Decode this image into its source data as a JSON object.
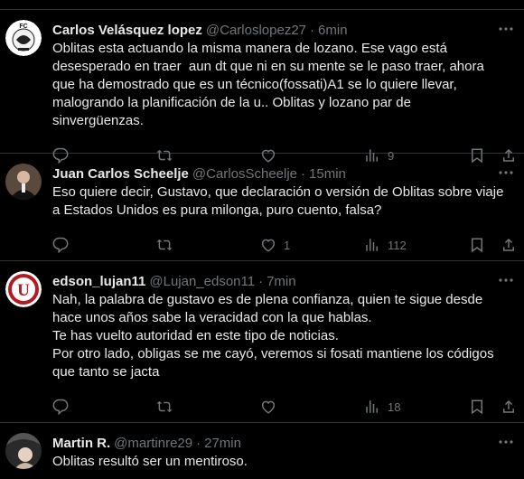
{
  "tweets": [
    {
      "display_name": "Carlos Velásquez lopez",
      "handle": "@Carloslopez27",
      "separator": "·",
      "time": "6min",
      "text": "Oblitas esta actuando la misma manera de lozano. Ese vago está desesperado en traer  aun dt que ni en su mente se le paso traer, ahora que ha demostrado que es un técnico(fossati)A1 se lo quiere llevar, malogrando la planificación de la u.. Oblitas y lozano par de sinvergüenzas.",
      "replies": "",
      "retweets": "",
      "likes": "",
      "views": "9",
      "avatar_label": "FC"
    },
    {
      "display_name": "Juan Carlos Scheelje",
      "handle": "@CarlosScheelje",
      "separator": "·",
      "time": "15min",
      "text": "Eso quiere decir, Gustavo, que declaración o versión de Oblitas sobre viaje a Estados Unidos es pura milonga, puro cuento, falsa?",
      "replies": "",
      "retweets": "",
      "likes": "1",
      "views": "112",
      "avatar_label": ""
    },
    {
      "display_name": "edson_lujan11",
      "handle": "@Lujan_edson11",
      "separator": "·",
      "time": "7min",
      "text": "Nah, la palabra de gustavo es de plena confianza, quien te sigue desde hace unos años sabe la veracidad con la que hablas.\nTe has vuelto autoridad en este tipo de noticias.\nPor otro lado, obligas se me cayó, veremos si fosati mantiene los códigos que tanto se jacta",
      "replies": "",
      "retweets": "",
      "likes": "",
      "views": "18",
      "avatar_label": "U"
    },
    {
      "display_name": "Martin R.",
      "handle": "@martinre29",
      "separator": "·",
      "time": "27min",
      "text": "Oblitas resultó ser un mentiroso.",
      "replies": "",
      "retweets": "",
      "likes": "",
      "views": "",
      "avatar_label": ""
    }
  ],
  "colors": {
    "background": "#000000",
    "text_primary": "#e7e9ea",
    "text_secondary": "#71767b",
    "divider": "#2f3336",
    "universitario_red": "#b11b22"
  },
  "icons": [
    "more-icon",
    "reply-icon",
    "retweet-icon",
    "like-icon",
    "views-icon",
    "bookmark-icon",
    "share-icon"
  ]
}
